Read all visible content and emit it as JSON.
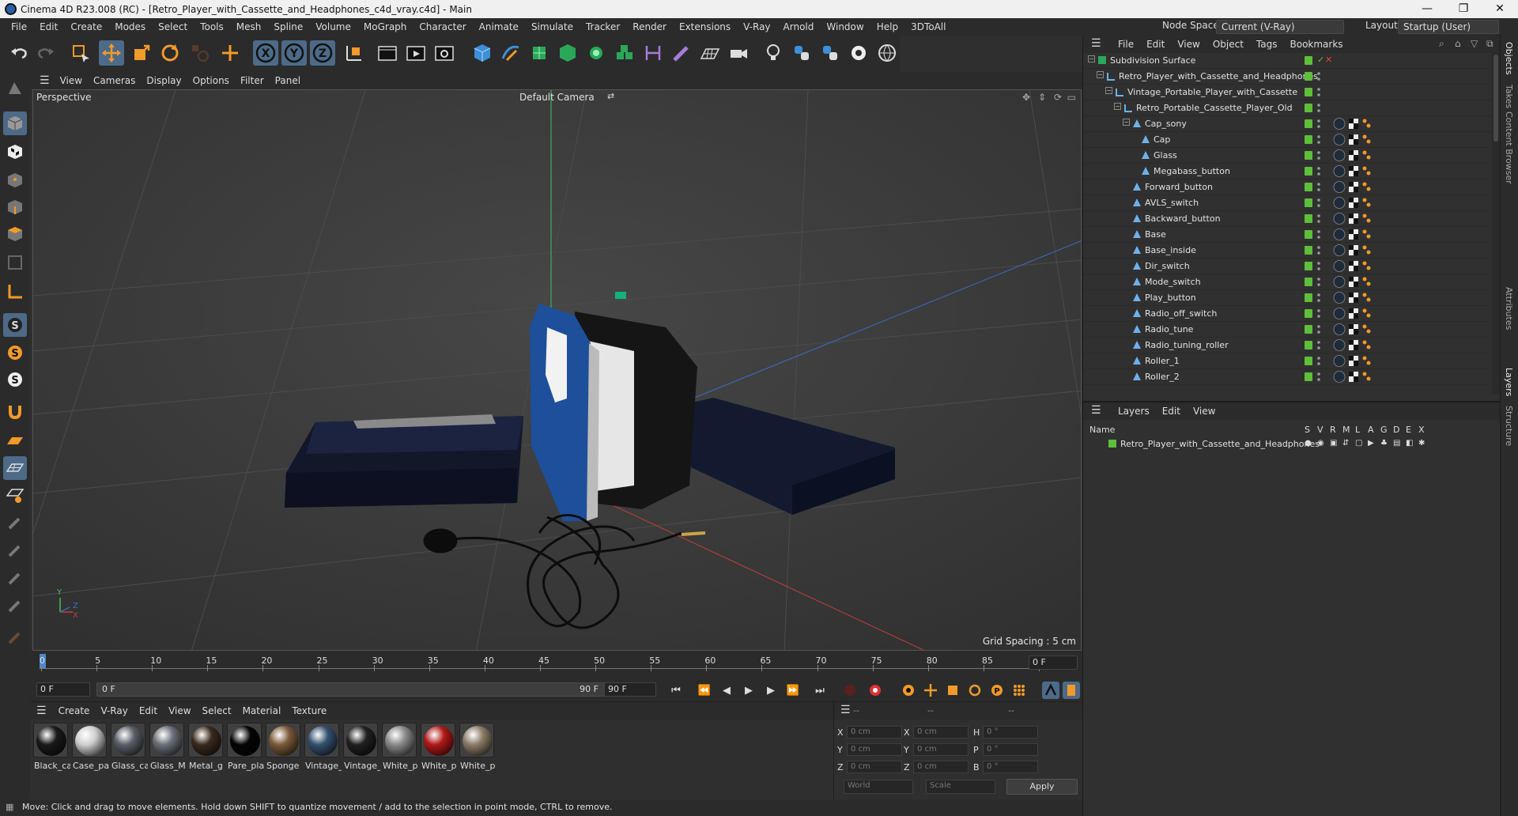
{
  "window": {
    "title": "Cinema 4D R23.008 (RC) - [Retro_Player_with_Cassette_and_Headphones_c4d_vray.c4d] - Main",
    "controls": [
      "—",
      "❐",
      "✕"
    ]
  },
  "menubar": {
    "items": [
      "File",
      "Edit",
      "Create",
      "Modes",
      "Select",
      "Tools",
      "Mesh",
      "Spline",
      "Volume",
      "MoGraph",
      "Character",
      "Animate",
      "Simulate",
      "Tracker",
      "Render",
      "Extensions",
      "V-Ray",
      "Arnold",
      "Window",
      "Help",
      "3DToAll"
    ],
    "node_space_label": "Node Space:",
    "node_space_value": "Current (V-Ray)",
    "layout_label": "Layout:",
    "layout_value": "Startup (User)"
  },
  "viewport": {
    "menu": [
      "View",
      "Cameras",
      "Display",
      "Options",
      "Filter",
      "Panel"
    ],
    "projection": "Perspective",
    "camera": "Default Camera",
    "grid_spacing": "Grid Spacing : 5 cm",
    "axis_y": "Y",
    "axis_z": "Z",
    "axis_x": "X"
  },
  "timeline": {
    "ticks": [
      "0",
      "5",
      "10",
      "15",
      "20",
      "25",
      "30",
      "35",
      "40",
      "45",
      "50",
      "55",
      "60",
      "65",
      "70",
      "75",
      "80",
      "85",
      "90"
    ],
    "current_frame": "0 F",
    "start_field": "0 F",
    "range_start": "0 F",
    "range_end": "90 F",
    "end_field": "90 F"
  },
  "materials": {
    "menu": [
      "Create",
      "V-Ray",
      "Edit",
      "View",
      "Select",
      "Material",
      "Texture"
    ],
    "items": [
      {
        "label": "Black_ca",
        "color": "#1a1a1a"
      },
      {
        "label": "Case_pa",
        "color": "#cfcfcf"
      },
      {
        "label": "Glass_ca",
        "color": "#5a5f66"
      },
      {
        "label": "Glass_M",
        "color": "#6a6f76"
      },
      {
        "label": "Metal_g",
        "color": "#3a2a1e"
      },
      {
        "label": "Pare_pla",
        "color": "#050505"
      },
      {
        "label": "Sponge",
        "color": "#7a5a3a"
      },
      {
        "label": "Vintage_",
        "color": "#34506e"
      },
      {
        "label": "Vintage_",
        "color": "#202020"
      },
      {
        "label": "White_p",
        "color": "#8a8a8a"
      },
      {
        "label": "White_p",
        "color": "#b01818"
      },
      {
        "label": "White_p",
        "color": "#8c7c68"
      }
    ]
  },
  "coordinates": {
    "header": [
      "--",
      "--",
      "--"
    ],
    "rows": [
      {
        "a": "X",
        "av": "0 cm",
        "b": "X",
        "bv": "0 cm",
        "c": "H",
        "cv": "0 °"
      },
      {
        "a": "Y",
        "av": "0 cm",
        "b": "Y",
        "bv": "0 cm",
        "c": "P",
        "cv": "0 °"
      },
      {
        "a": "Z",
        "av": "0 cm",
        "b": "Z",
        "bv": "0 cm",
        "c": "B",
        "cv": "0 °"
      }
    ],
    "world": "World",
    "scale": "Scale",
    "apply": "Apply"
  },
  "status": "Move: Click and drag to move elements. Hold down SHIFT to quantize movement / add to the selection in point mode, CTRL to remove.",
  "objects": {
    "menu": [
      "File",
      "Edit",
      "View",
      "Object",
      "Tags",
      "Bookmarks"
    ],
    "rows": [
      {
        "name": "Subdivision Surface",
        "depth": 0,
        "kind": "sub",
        "tags": false
      },
      {
        "name": "Retro_Player_with_Cassette_and_Headphones",
        "depth": 1,
        "kind": "null",
        "tags": false
      },
      {
        "name": "Vintage_Portable_Player_with_Cassette",
        "depth": 2,
        "kind": "null",
        "tags": false
      },
      {
        "name": "Retro_Portable_Cassette_Player_Old",
        "depth": 3,
        "kind": "null",
        "tags": false
      },
      {
        "name": "Cap_sony",
        "depth": 4,
        "kind": "poly",
        "tags": true
      },
      {
        "name": "Cap",
        "depth": 5,
        "kind": "poly",
        "tags": true
      },
      {
        "name": "Glass",
        "depth": 5,
        "kind": "poly",
        "tags": true
      },
      {
        "name": "Megabass_button",
        "depth": 5,
        "kind": "poly",
        "tags": true
      },
      {
        "name": "Forward_button",
        "depth": 4,
        "kind": "poly",
        "tags": true
      },
      {
        "name": "AVLS_switch",
        "depth": 4,
        "kind": "poly",
        "tags": true
      },
      {
        "name": "Backward_button",
        "depth": 4,
        "kind": "poly",
        "tags": true
      },
      {
        "name": "Base",
        "depth": 4,
        "kind": "poly",
        "tags": true
      },
      {
        "name": "Base_inside",
        "depth": 4,
        "kind": "poly",
        "tags": true
      },
      {
        "name": "Dir_switch",
        "depth": 4,
        "kind": "poly",
        "tags": true
      },
      {
        "name": "Mode_switch",
        "depth": 4,
        "kind": "poly",
        "tags": true
      },
      {
        "name": "Play_button",
        "depth": 4,
        "kind": "poly",
        "tags": true
      },
      {
        "name": "Radio_off_switch",
        "depth": 4,
        "kind": "poly",
        "tags": true
      },
      {
        "name": "Radio_tune",
        "depth": 4,
        "kind": "poly",
        "tags": true
      },
      {
        "name": "Radio_tuning_roller",
        "depth": 4,
        "kind": "poly",
        "tags": true
      },
      {
        "name": "Roller_1",
        "depth": 4,
        "kind": "poly",
        "tags": true
      },
      {
        "name": "Roller_2",
        "depth": 4,
        "kind": "poly",
        "tags": true
      }
    ]
  },
  "layers": {
    "menu": [
      "Layers",
      "Edit",
      "View"
    ],
    "columns": [
      "Name",
      "S",
      "V",
      "R",
      "M",
      "L",
      "A",
      "G",
      "D",
      "E",
      "X"
    ],
    "rows": [
      {
        "name": "Retro_Player_with_Cassette_and_Headphones",
        "color": "#5fbe3a"
      }
    ]
  },
  "side_tabs": [
    "Objects",
    "Takes",
    "Content Browser",
    "Attributes",
    "Layers",
    "Structure"
  ],
  "colors": {
    "accent": "#4d6a88",
    "green": "#5fbe3a",
    "axis_x": "#c43c3c",
    "axis_y": "#3cc45a",
    "axis_z": "#3c6ac4"
  }
}
